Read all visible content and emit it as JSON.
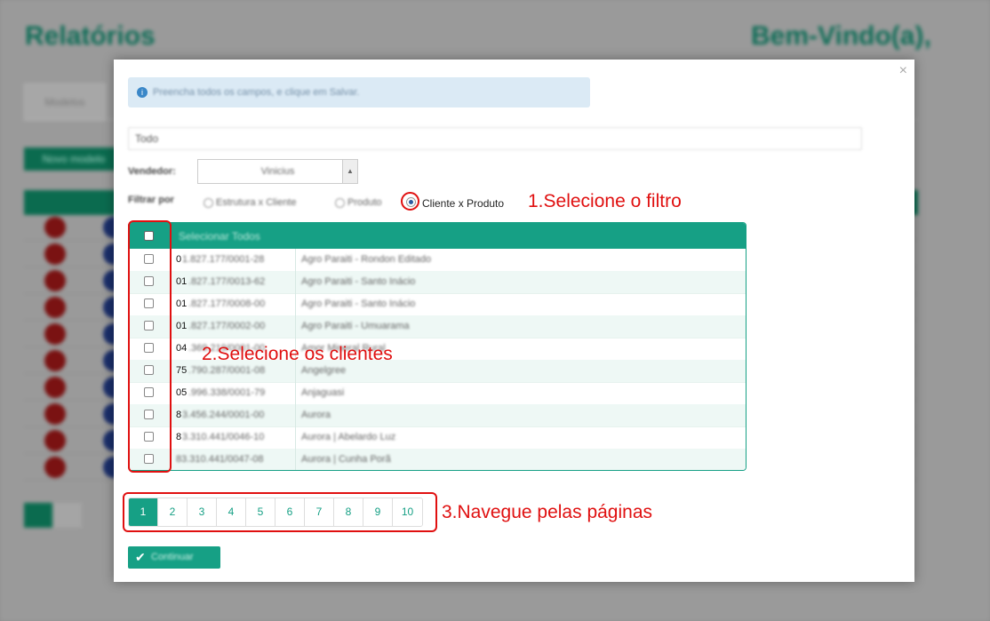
{
  "background": {
    "title": "Relatórios",
    "welcome": "Bem-Vindo(a),",
    "tab": "Modelos",
    "new_button": "Novo modelo"
  },
  "modal": {
    "alert_text": "Preencha todos os campos, e clique em Salvar.",
    "name_value": "Todo",
    "vendedor_label": "Vendedor:",
    "vendedor_value": "Vinicius",
    "filter_label": "Filtrar por",
    "filter_options": [
      {
        "label": "Estrutura x Cliente",
        "selected": false
      },
      {
        "label": "Produto",
        "selected": false
      },
      {
        "label": "Cliente x Produto",
        "selected": true
      }
    ],
    "select_all_label": "Selecionar Todos",
    "clients": [
      {
        "code_prefix": "0",
        "code_rest": "1.827.177/0001-28",
        "name": "Agro Paraiti - Rondon Editado"
      },
      {
        "code_prefix": "01",
        "code_rest": ".827.177/0013-62",
        "name": "Agro Paraiti - Santo Inácio"
      },
      {
        "code_prefix": "01",
        "code_rest": ".827.177/0008-00",
        "name": "Agro Paraiti - Santo Inácio"
      },
      {
        "code_prefix": "01",
        "code_rest": ".827.177/0002-00",
        "name": "Agro Paraiti - Umuarama"
      },
      {
        "code_prefix": "04",
        "code_rest": ".369.219/0001-00",
        "name": "Amor Mineral Rural"
      },
      {
        "code_prefix": "75",
        "code_rest": ".790.287/0001-08",
        "name": "Angelgree"
      },
      {
        "code_prefix": "05",
        "code_rest": ".996.338/0001-79",
        "name": "Anjaguasi"
      },
      {
        "code_prefix": "8",
        "code_rest": "3.456.244/0001-00",
        "name": "Aurora"
      },
      {
        "code_prefix": "8",
        "code_rest": "3.310.441/0046-10",
        "name": "Aurora | Abelardo Luz"
      },
      {
        "code_prefix": "",
        "code_rest": "83.310.441/0047-08",
        "name": "Aurora | Cunha Porã"
      }
    ],
    "pages": [
      "1",
      "2",
      "3",
      "4",
      "5",
      "6",
      "7",
      "8",
      "9",
      "10"
    ],
    "active_page": "1",
    "continue_label": "Continuar",
    "close_glyph": "×"
  },
  "annotations": {
    "step1": "1.Selecione o filtro",
    "step2": "2.Selecione os clientes",
    "step3": "3.Navegue pelas páginas"
  },
  "colors": {
    "accent": "#16a085",
    "annotation": "#e01010"
  }
}
